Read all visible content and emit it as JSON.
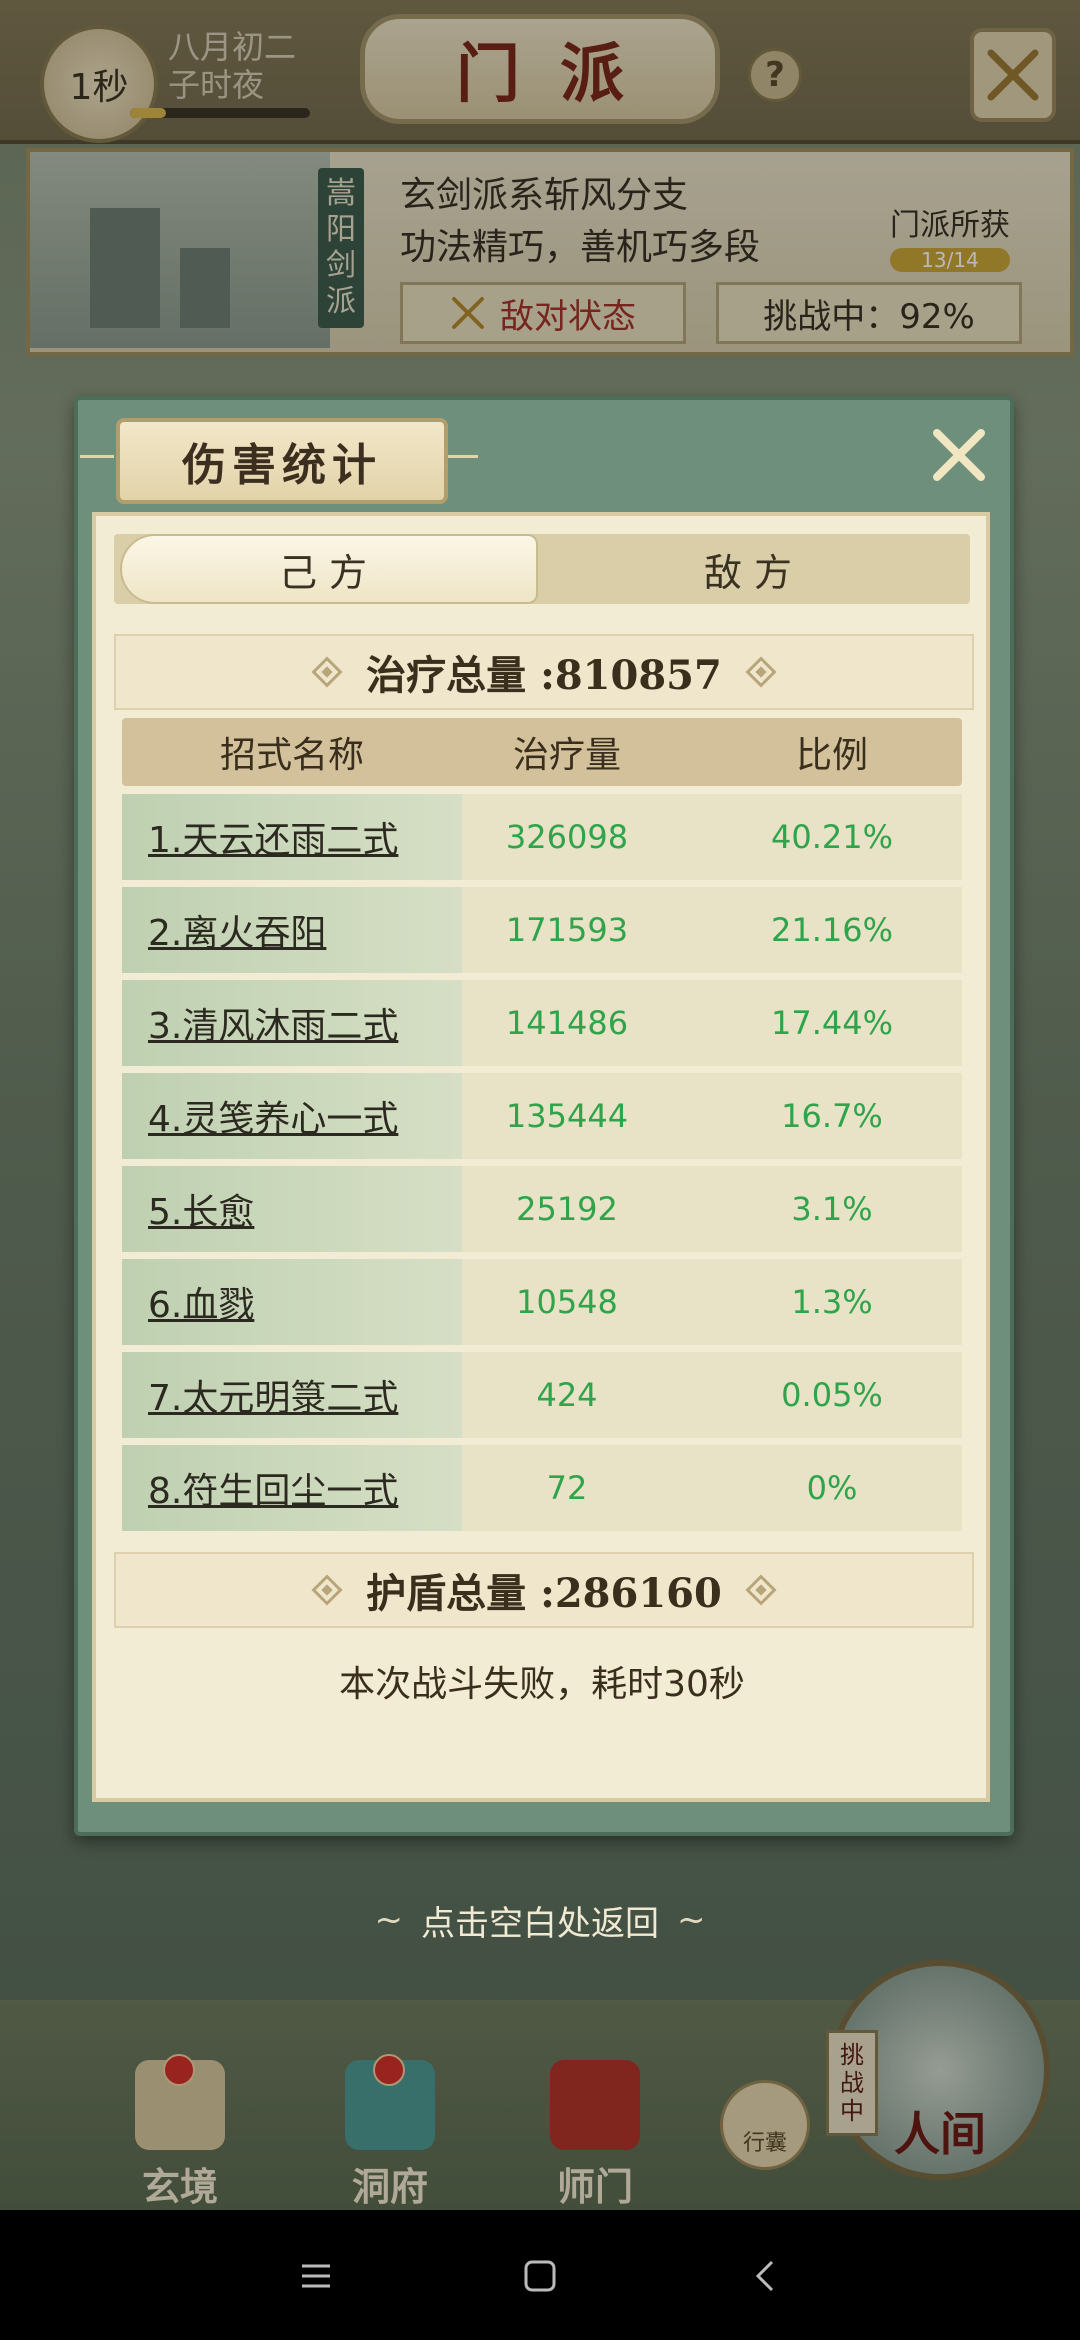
{
  "top_bar": {
    "timer": "1秒",
    "date_line1": "八月初二",
    "date_line2": "子时夜",
    "title": "门派",
    "help": "?"
  },
  "sect": {
    "vertical_name": [
      "嵩",
      "阳",
      "剑",
      "派"
    ],
    "desc_line1": "玄剑派系斩风分支",
    "desc_line2": "功法精巧，善机巧多段",
    "enemy_state": "敌对状态",
    "challenge_status": "挑战中：92%",
    "gain_label": "门派所获",
    "gain_count": "13/14"
  },
  "modal": {
    "title": "伤害统计",
    "tabs": [
      {
        "label": "己方",
        "active": true
      },
      {
        "label": "敌方",
        "active": false
      }
    ],
    "heal_total_label": "治疗总量 :810857",
    "columns": [
      "招式名称",
      "治疗量",
      "比例"
    ],
    "rows": [
      {
        "name": "1.天云还雨二式",
        "amount": "326098",
        "ratio": "40.21%"
      },
      {
        "name": "2.离火吞阳",
        "amount": "171593",
        "ratio": "21.16%"
      },
      {
        "name": "3.清风沐雨二式",
        "amount": "141486",
        "ratio": "17.44%"
      },
      {
        "name": "4.灵笺养心一式",
        "amount": "135444",
        "ratio": "16.7%"
      },
      {
        "name": "5.长愈",
        "amount": "25192",
        "ratio": "3.1%"
      },
      {
        "name": "6.血戮",
        "amount": "10548",
        "ratio": "1.3%"
      },
      {
        "name": "7.太元明箓二式",
        "amount": "424",
        "ratio": "0.05%"
      },
      {
        "name": "8.符生回尘一式",
        "amount": "72",
        "ratio": "0%"
      }
    ],
    "shield_total_label": "护盾总量 :286160",
    "result": "本次战斗失败，耗时30秒"
  },
  "return_hint": "点击空白处返回",
  "bottom_nav": {
    "items": [
      "玄境",
      "洞府",
      "师门"
    ],
    "bag": "行囊",
    "challenging": [
      "挑",
      "战",
      "中"
    ],
    "world": "人间"
  },
  "colors": {
    "accent_green": "#2fa44a",
    "modal_frame": "#6d8f7b",
    "danger_red": "#a4352a"
  }
}
